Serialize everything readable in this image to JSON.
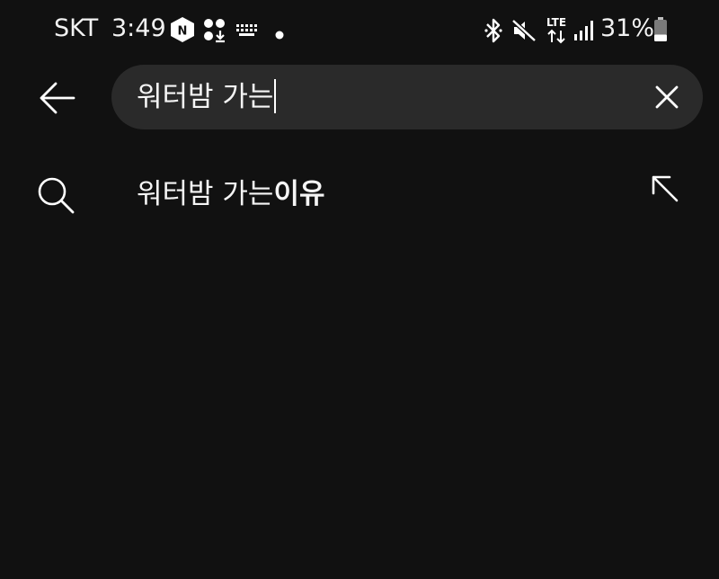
{
  "status_bar": {
    "carrier": "SKT",
    "time": "3:49",
    "network": "LTE",
    "battery_percent": "31%",
    "battery_level": 0.31,
    "icons": [
      "naver-icon",
      "app-dots-icon",
      "keyboard-icon",
      "dot-icon",
      "bluetooth-icon",
      "mute-icon",
      "lte-icon",
      "signal-icon",
      "battery-icon"
    ]
  },
  "search": {
    "query": "워터밤 가는",
    "back_icon": "arrow-left-icon",
    "clear_icon": "close-icon"
  },
  "suggestions": [
    {
      "match": "워터밤 가는",
      "rest": "이유",
      "icon": "search-icon",
      "action_icon": "arrow-up-left-icon"
    }
  ],
  "colors": {
    "background": "#111111",
    "search_field": "#2a2a2a",
    "text": "#f5f5f5"
  }
}
